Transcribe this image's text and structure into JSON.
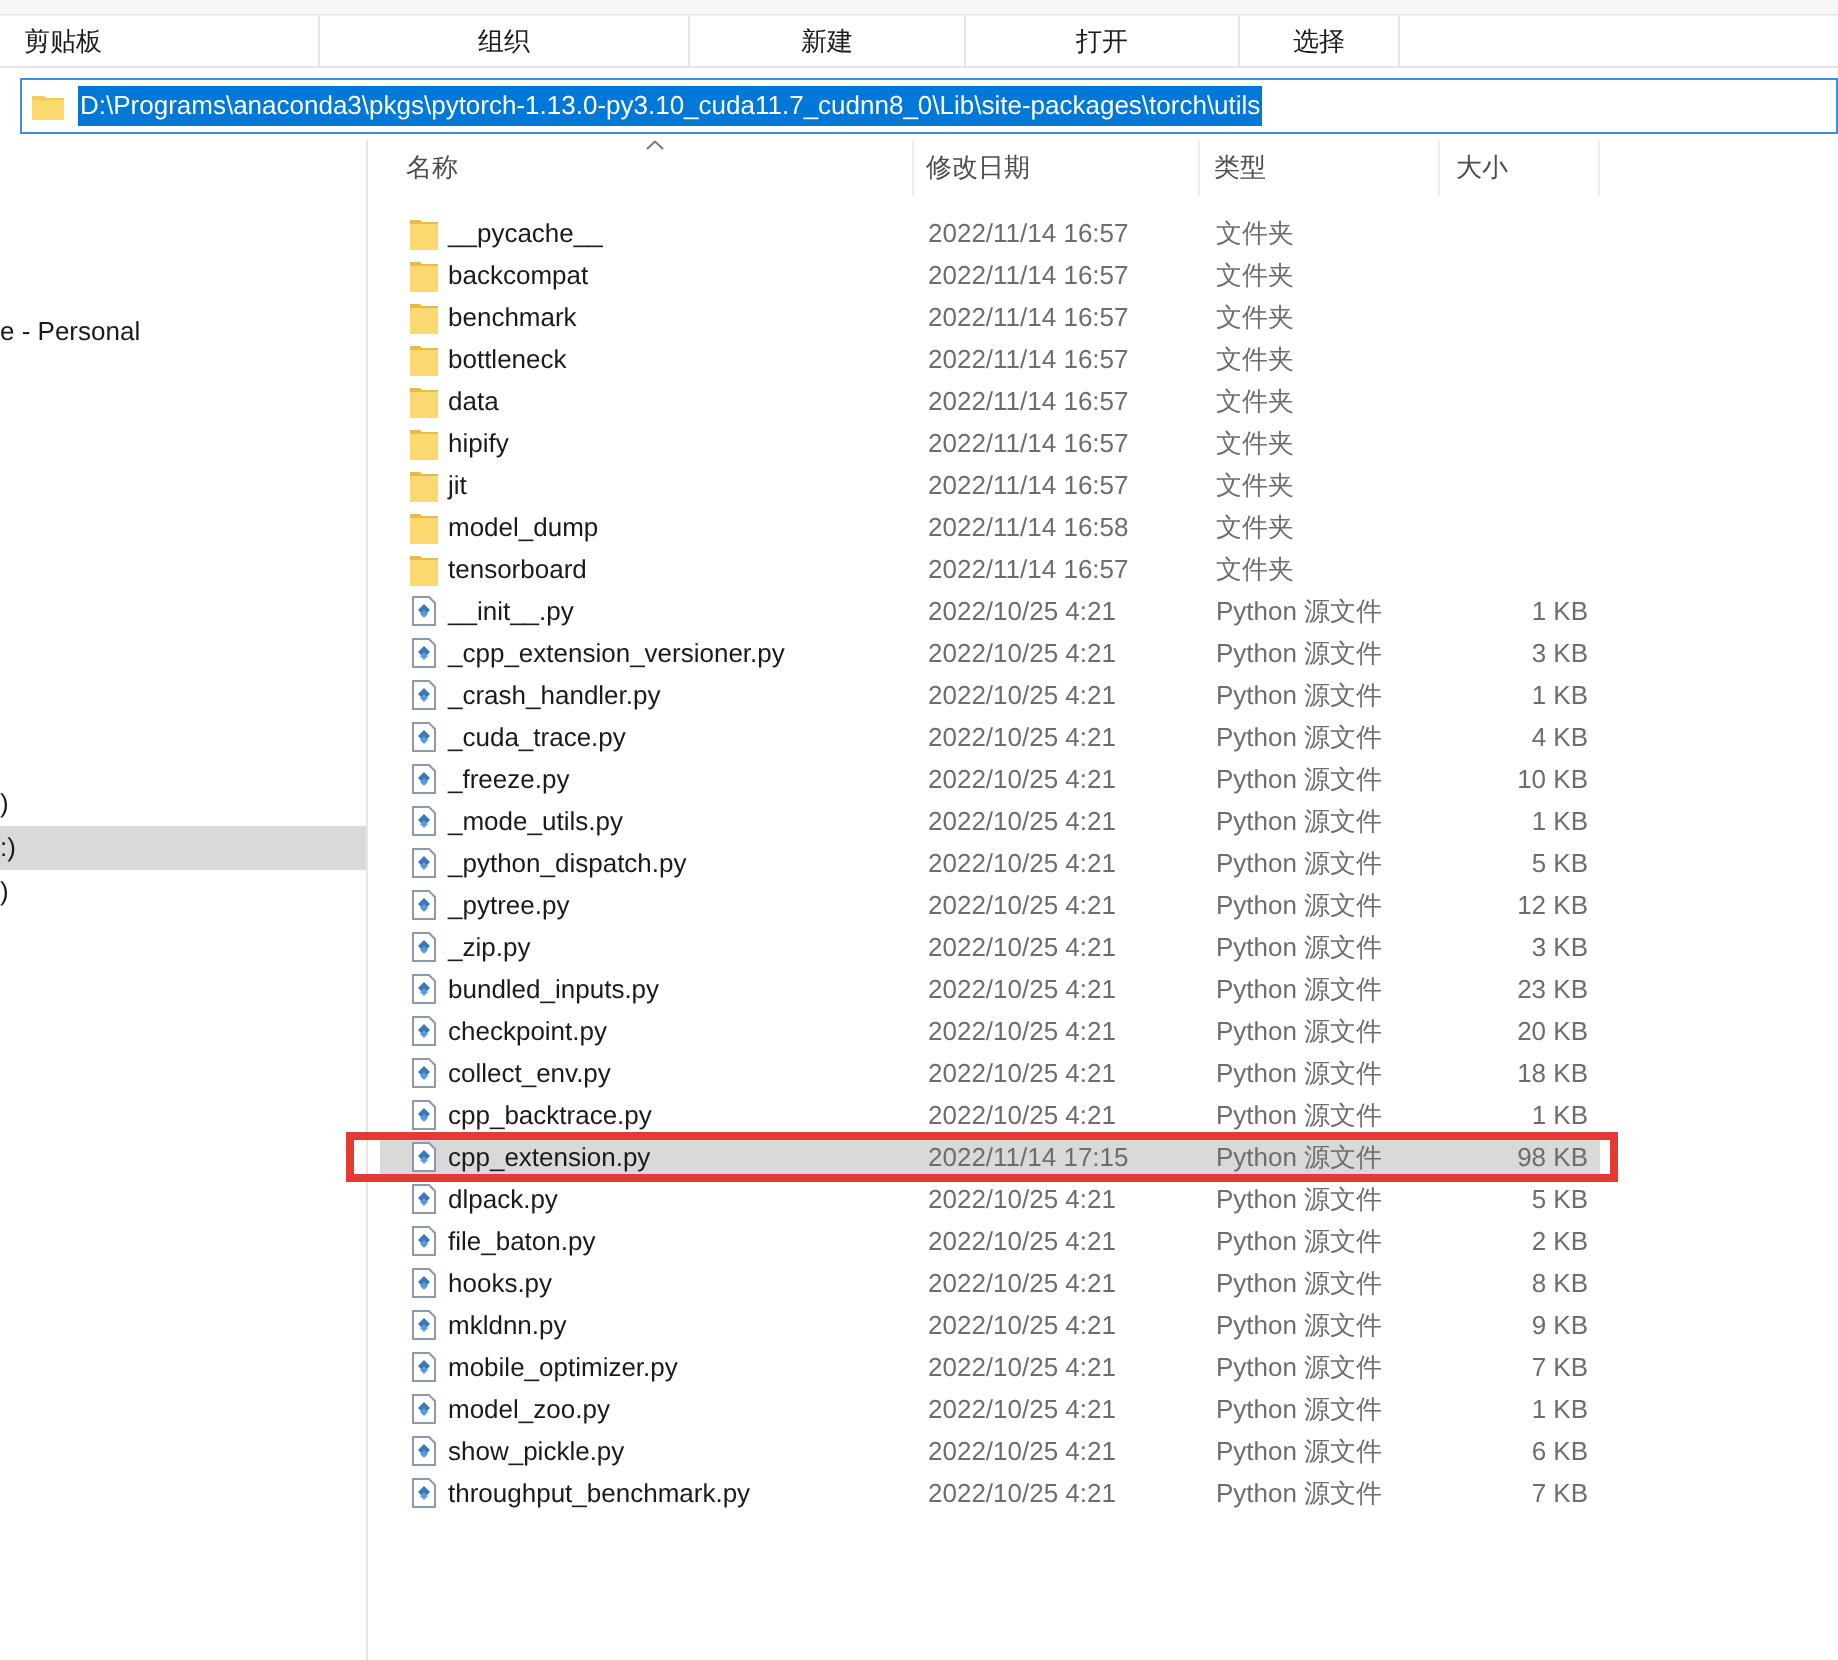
{
  "ribbon": {
    "groups": [
      "剪贴板",
      "组织",
      "新建",
      "打开",
      "选择"
    ]
  },
  "address_bar": {
    "value": "D:\\Programs\\anaconda3\\pkgs\\pytorch-1.13.0-py3.10_cuda11.7_cudnn8_0\\Lib\\site-packages\\torch\\utils",
    "text_selected": true
  },
  "sidebar": {
    "items": [
      {
        "label": "e - Personal",
        "selected": false
      },
      {
        "label": ")",
        "selected": false
      },
      {
        "label": ":)",
        "selected": true
      },
      {
        "label": ")",
        "selected": false
      }
    ]
  },
  "table": {
    "columns": [
      {
        "label": "名称",
        "sorted": true
      },
      {
        "label": "修改日期",
        "sorted": false
      },
      {
        "label": "类型",
        "sorted": false
      },
      {
        "label": "大小",
        "sorted": false
      }
    ],
    "rows": [
      {
        "kind": "folder",
        "name": "__pycache__",
        "modified": "2022/11/14 16:57",
        "type": "文件夹",
        "selected": false,
        "outlined": false
      },
      {
        "kind": "folder",
        "name": "backcompat",
        "modified": "2022/11/14 16:57",
        "type": "文件夹",
        "selected": false,
        "outlined": false
      },
      {
        "kind": "folder",
        "name": "benchmark",
        "modified": "2022/11/14 16:57",
        "type": "文件夹",
        "selected": false,
        "outlined": false
      },
      {
        "kind": "folder",
        "name": "bottleneck",
        "modified": "2022/11/14 16:57",
        "type": "文件夹",
        "selected": false,
        "outlined": false
      },
      {
        "kind": "folder",
        "name": "data",
        "modified": "2022/11/14 16:57",
        "type": "文件夹",
        "selected": false,
        "outlined": false
      },
      {
        "kind": "folder",
        "name": "hipify",
        "modified": "2022/11/14 16:57",
        "type": "文件夹",
        "selected": false,
        "outlined": false
      },
      {
        "kind": "folder",
        "name": "jit",
        "modified": "2022/11/14 16:57",
        "type": "文件夹",
        "selected": false,
        "outlined": false
      },
      {
        "kind": "folder",
        "name": "model_dump",
        "modified": "2022/11/14 16:58",
        "type": "文件夹",
        "selected": false,
        "outlined": false
      },
      {
        "kind": "folder",
        "name": "tensorboard",
        "modified": "2022/11/14 16:57",
        "type": "文件夹",
        "selected": false,
        "outlined": false
      },
      {
        "kind": "python",
        "name": "__init__.py",
        "modified": "2022/10/25 4:21",
        "type": "Python 源文件",
        "size": "1 KB",
        "selected": false,
        "outlined": false
      },
      {
        "kind": "python",
        "name": "_cpp_extension_versioner.py",
        "modified": "2022/10/25 4:21",
        "type": "Python 源文件",
        "size": "3 KB",
        "selected": false,
        "outlined": false
      },
      {
        "kind": "python",
        "name": "_crash_handler.py",
        "modified": "2022/10/25 4:21",
        "type": "Python 源文件",
        "size": "1 KB",
        "selected": false,
        "outlined": false
      },
      {
        "kind": "python",
        "name": "_cuda_trace.py",
        "modified": "2022/10/25 4:21",
        "type": "Python 源文件",
        "size": "4 KB",
        "selected": false,
        "outlined": false
      },
      {
        "kind": "python",
        "name": "_freeze.py",
        "modified": "2022/10/25 4:21",
        "type": "Python 源文件",
        "size": "10 KB",
        "selected": false,
        "outlined": false
      },
      {
        "kind": "python",
        "name": "_mode_utils.py",
        "modified": "2022/10/25 4:21",
        "type": "Python 源文件",
        "size": "1 KB",
        "selected": false,
        "outlined": false
      },
      {
        "kind": "python",
        "name": "_python_dispatch.py",
        "modified": "2022/10/25 4:21",
        "type": "Python 源文件",
        "size": "5 KB",
        "selected": false,
        "outlined": false
      },
      {
        "kind": "python",
        "name": "_pytree.py",
        "modified": "2022/10/25 4:21",
        "type": "Python 源文件",
        "size": "12 KB",
        "selected": false,
        "outlined": false
      },
      {
        "kind": "python",
        "name": "_zip.py",
        "modified": "2022/10/25 4:21",
        "type": "Python 源文件",
        "size": "3 KB",
        "selected": false,
        "outlined": false
      },
      {
        "kind": "python",
        "name": "bundled_inputs.py",
        "modified": "2022/10/25 4:21",
        "type": "Python 源文件",
        "size": "23 KB",
        "selected": false,
        "outlined": false
      },
      {
        "kind": "python",
        "name": "checkpoint.py",
        "modified": "2022/10/25 4:21",
        "type": "Python 源文件",
        "size": "20 KB",
        "selected": false,
        "outlined": false
      },
      {
        "kind": "python",
        "name": "collect_env.py",
        "modified": "2022/10/25 4:21",
        "type": "Python 源文件",
        "size": "18 KB",
        "selected": false,
        "outlined": false
      },
      {
        "kind": "python",
        "name": "cpp_backtrace.py",
        "modified": "2022/10/25 4:21",
        "type": "Python 源文件",
        "size": "1 KB",
        "selected": false,
        "outlined": false
      },
      {
        "kind": "python",
        "name": "cpp_extension.py",
        "modified": "2022/11/14 17:15",
        "type": "Python 源文件",
        "size": "98 KB",
        "selected": true,
        "outlined": true
      },
      {
        "kind": "python",
        "name": "dlpack.py",
        "modified": "2022/10/25 4:21",
        "type": "Python 源文件",
        "size": "5 KB",
        "selected": false,
        "outlined": false
      },
      {
        "kind": "python",
        "name": "file_baton.py",
        "modified": "2022/10/25 4:21",
        "type": "Python 源文件",
        "size": "2 KB",
        "selected": false,
        "outlined": false
      },
      {
        "kind": "python",
        "name": "hooks.py",
        "modified": "2022/10/25 4:21",
        "type": "Python 源文件",
        "size": "8 KB",
        "selected": false,
        "outlined": false
      },
      {
        "kind": "python",
        "name": "mkldnn.py",
        "modified": "2022/10/25 4:21",
        "type": "Python 源文件",
        "size": "9 KB",
        "selected": false,
        "outlined": false
      },
      {
        "kind": "python",
        "name": "mobile_optimizer.py",
        "modified": "2022/10/25 4:21",
        "type": "Python 源文件",
        "size": "7 KB",
        "selected": false,
        "outlined": false
      },
      {
        "kind": "python",
        "name": "model_zoo.py",
        "modified": "2022/10/25 4:21",
        "type": "Python 源文件",
        "size": "1 KB",
        "selected": false,
        "outlined": false
      },
      {
        "kind": "python",
        "name": "show_pickle.py",
        "modified": "2022/10/25 4:21",
        "type": "Python 源文件",
        "size": "6 KB",
        "selected": false,
        "outlined": false
      },
      {
        "kind": "python",
        "name": "throughput_benchmark.py",
        "modified": "2022/10/25 4:21",
        "type": "Python 源文件",
        "size": "7 KB",
        "selected": false,
        "outlined": false
      }
    ]
  }
}
